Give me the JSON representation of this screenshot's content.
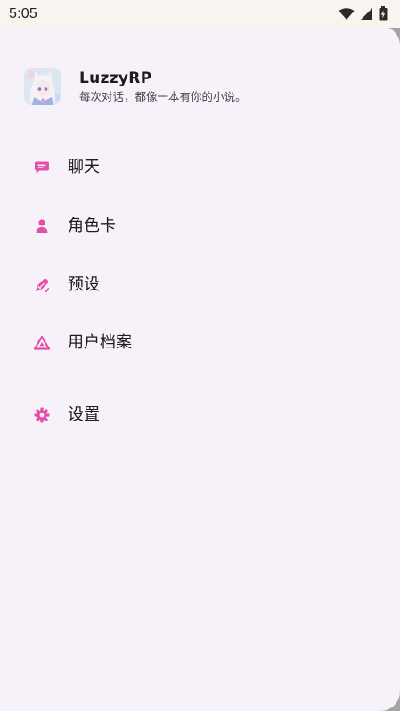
{
  "status_bar": {
    "time": "5:05"
  },
  "drawer": {
    "app_name": "LuzzyRP",
    "tagline": "每次对话，都像一本有你的小说。",
    "accent_color": "#e64fa9",
    "items": [
      {
        "label": "聊天",
        "icon": "chat-bubble-icon"
      },
      {
        "label": "角色卡",
        "icon": "person-icon"
      },
      {
        "label": "预设",
        "icon": "edit-pen-icon"
      },
      {
        "label": "用户档案",
        "icon": "triangle-icon"
      },
      {
        "label": "设置",
        "icon": "gear-icon"
      }
    ]
  }
}
